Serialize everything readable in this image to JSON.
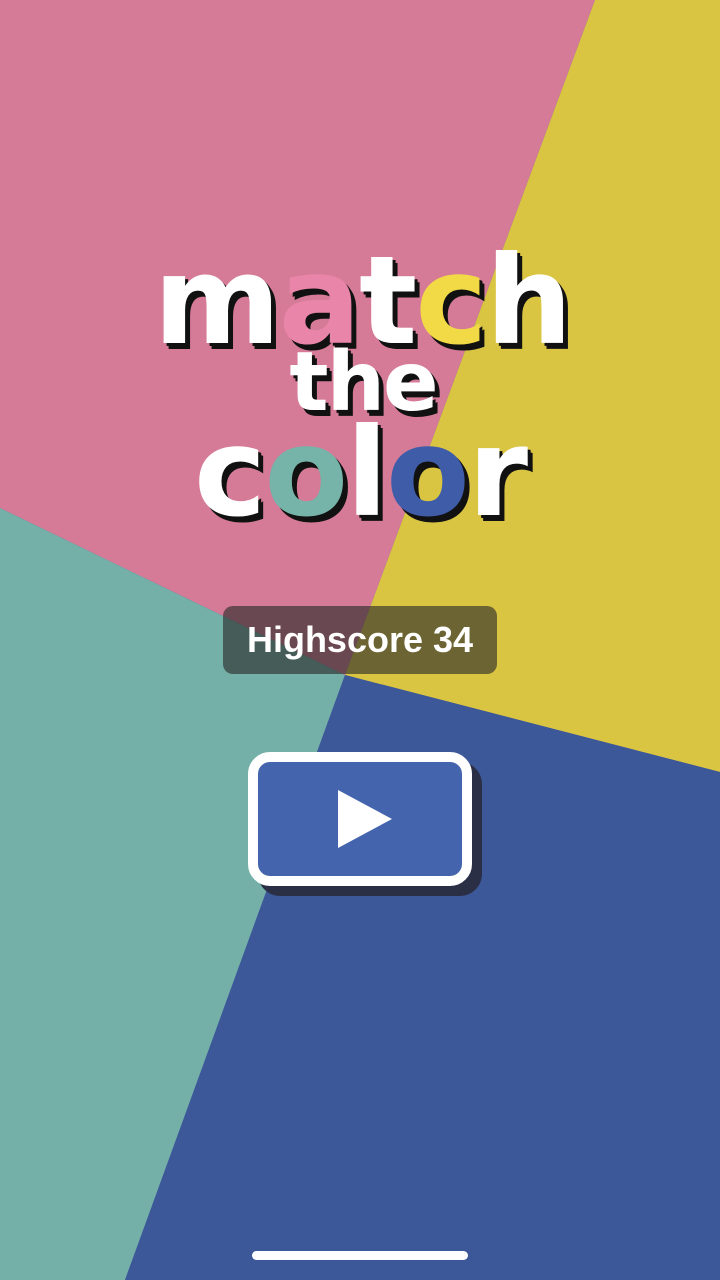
{
  "title": {
    "line1": [
      "m",
      "a",
      "t",
      "c",
      "h"
    ],
    "line2": [
      "t",
      "h",
      "e"
    ],
    "line3": [
      "c",
      "o",
      "l",
      "o",
      "r"
    ],
    "letter_colors": {
      "white": "#ffffff",
      "pink": "#e985a8",
      "yellow": "#f1da45",
      "teal": "#76b3a8",
      "blue": "#3f5ca8"
    }
  },
  "highscore": {
    "label": "Highscore",
    "value": "34"
  },
  "play_button": {
    "icon": "play-icon"
  },
  "colors": {
    "pink": "#d57b97",
    "yellow": "#dac543",
    "teal": "#74b0a7",
    "blue": "#3d5899",
    "button_fill": "#4465ae"
  }
}
